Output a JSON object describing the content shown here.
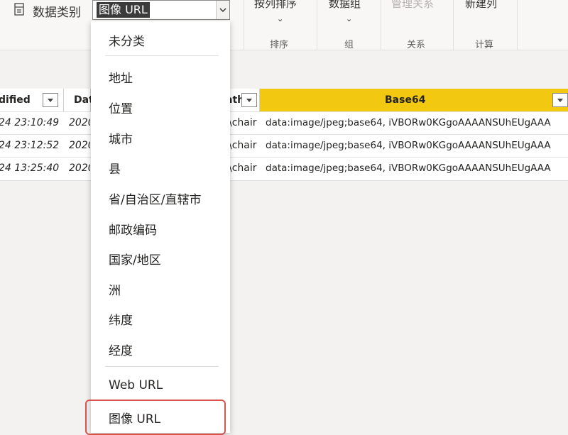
{
  "ribbon": {
    "data_category_label": "数据类别",
    "data_category_value": "图像 URL",
    "sort_by_column": "按列排序",
    "sort_group": "排序",
    "data_groups": "数据组",
    "groups_group": "组",
    "manage_relationships": "管理关系",
    "relationships_group": "关系",
    "new_column": "新建列",
    "calculations_group": "计算"
  },
  "table": {
    "headers": [
      "dified",
      "Dat",
      "ath",
      "Base64"
    ],
    "rows": [
      {
        "modified": "24 23:10:49",
        "date": "2020",
        "path": "\\chair",
        "base64": "data:image/jpeg;base64, iVBORw0KGgoAAAANSUhEUgAAA"
      },
      {
        "modified": "24 23:12:52",
        "date": "2020",
        "path": "\\chair",
        "base64": "data:image/jpeg;base64, iVBORw0KGgoAAAANSUhEUgAAA"
      },
      {
        "modified": "24 13:25:40",
        "date": "2020",
        "path": "\\chair",
        "base64": "data:image/jpeg;base64, iVBORw0KGgoAAAANSUhEUgAAA"
      }
    ]
  },
  "dropdown": {
    "items": [
      "未分类",
      "地址",
      "位置",
      "城市",
      "县",
      "省/自治区/直辖市",
      "邮政编码",
      "国家/地区",
      "洲",
      "纬度",
      "经度",
      "Web URL",
      "图像 URL"
    ]
  }
}
